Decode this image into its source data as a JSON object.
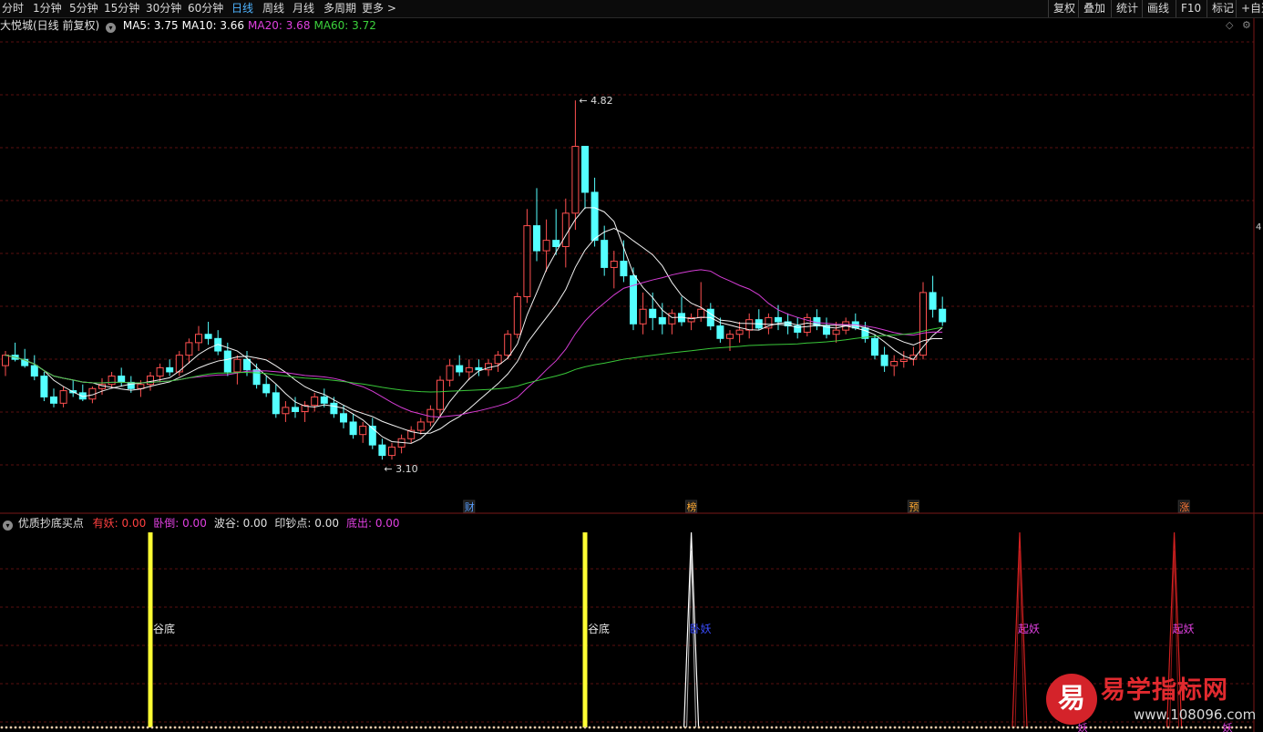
{
  "toolbar": {
    "periods": [
      {
        "label": "分时",
        "active": false
      },
      {
        "label": "1分钟",
        "active": false
      },
      {
        "label": "5分钟",
        "active": false
      },
      {
        "label": "15分钟",
        "active": false
      },
      {
        "label": "30分钟",
        "active": false
      },
      {
        "label": "60分钟",
        "active": false
      },
      {
        "label": "日线",
        "active": true
      },
      {
        "label": "周线",
        "active": false
      },
      {
        "label": "月线",
        "active": false
      },
      {
        "label": "多周期",
        "active": false
      },
      {
        "label": "更多 >",
        "active": false
      }
    ],
    "right_buttons": [
      "复权",
      "叠加",
      "统计",
      "画线",
      "F10",
      "标记",
      "+自选"
    ]
  },
  "main_chart": {
    "title": "大悦城(日线 前复权)",
    "ma": [
      {
        "label": "MA5: 3.75",
        "color": "#ffffff"
      },
      {
        "label": "MA10: 3.66",
        "color": "#ffffff"
      },
      {
        "label": "MA20: 3.68",
        "color": "#e040e0"
      },
      {
        "label": "MA60: 3.72",
        "color": "#3cd23c"
      }
    ],
    "high_label": "4.82",
    "low_label": "3.10",
    "edge_label": "4",
    "event_markers": [
      "财",
      "榜",
      "预",
      "涨"
    ]
  },
  "chart_data": {
    "type": "candlestick",
    "price_range": [
      2.9,
      5.1
    ],
    "high": 4.82,
    "low": 3.1,
    "candles": [
      [
        3.55,
        3.62,
        3.5,
        3.6
      ],
      [
        3.6,
        3.66,
        3.57,
        3.58
      ],
      [
        3.58,
        3.63,
        3.54,
        3.55
      ],
      [
        3.55,
        3.6,
        3.48,
        3.5
      ],
      [
        3.5,
        3.52,
        3.38,
        3.4
      ],
      [
        3.4,
        3.44,
        3.35,
        3.37
      ],
      [
        3.37,
        3.45,
        3.35,
        3.43
      ],
      [
        3.43,
        3.48,
        3.4,
        3.42
      ],
      [
        3.42,
        3.46,
        3.38,
        3.39
      ],
      [
        3.39,
        3.45,
        3.37,
        3.44
      ],
      [
        3.44,
        3.49,
        3.41,
        3.46
      ],
      [
        3.46,
        3.52,
        3.44,
        3.5
      ],
      [
        3.5,
        3.54,
        3.45,
        3.47
      ],
      [
        3.47,
        3.5,
        3.42,
        3.44
      ],
      [
        3.44,
        3.48,
        3.4,
        3.46
      ],
      [
        3.46,
        3.52,
        3.43,
        3.5
      ],
      [
        3.5,
        3.56,
        3.47,
        3.54
      ],
      [
        3.54,
        3.58,
        3.5,
        3.52
      ],
      [
        3.52,
        3.62,
        3.5,
        3.6
      ],
      [
        3.6,
        3.68,
        3.56,
        3.66
      ],
      [
        3.66,
        3.74,
        3.62,
        3.7
      ],
      [
        3.7,
        3.76,
        3.65,
        3.68
      ],
      [
        3.68,
        3.72,
        3.6,
        3.62
      ],
      [
        3.62,
        3.66,
        3.5,
        3.52
      ],
      [
        3.52,
        3.6,
        3.46,
        3.58
      ],
      [
        3.58,
        3.62,
        3.5,
        3.53
      ],
      [
        3.53,
        3.56,
        3.44,
        3.46
      ],
      [
        3.46,
        3.5,
        3.4,
        3.42
      ],
      [
        3.42,
        3.46,
        3.3,
        3.32
      ],
      [
        3.32,
        3.38,
        3.28,
        3.35
      ],
      [
        3.35,
        3.4,
        3.3,
        3.33
      ],
      [
        3.33,
        3.38,
        3.28,
        3.36
      ],
      [
        3.36,
        3.42,
        3.33,
        3.4
      ],
      [
        3.4,
        3.44,
        3.35,
        3.37
      ],
      [
        3.37,
        3.4,
        3.3,
        3.32
      ],
      [
        3.32,
        3.36,
        3.25,
        3.28
      ],
      [
        3.28,
        3.32,
        3.2,
        3.22
      ],
      [
        3.22,
        3.28,
        3.18,
        3.26
      ],
      [
        3.26,
        3.3,
        3.15,
        3.17
      ],
      [
        3.17,
        3.2,
        3.1,
        3.12
      ],
      [
        3.12,
        3.18,
        3.1,
        3.16
      ],
      [
        3.16,
        3.22,
        3.13,
        3.2
      ],
      [
        3.2,
        3.26,
        3.18,
        3.24
      ],
      [
        3.24,
        3.3,
        3.22,
        3.28
      ],
      [
        3.28,
        3.36,
        3.26,
        3.34
      ],
      [
        3.34,
        3.5,
        3.3,
        3.48
      ],
      [
        3.48,
        3.58,
        3.45,
        3.55
      ],
      [
        3.55,
        3.6,
        3.5,
        3.52
      ],
      [
        3.52,
        3.58,
        3.48,
        3.54
      ],
      [
        3.54,
        3.58,
        3.5,
        3.53
      ],
      [
        3.53,
        3.58,
        3.5,
        3.56
      ],
      [
        3.56,
        3.62,
        3.52,
        3.6
      ],
      [
        3.6,
        3.72,
        3.58,
        3.7
      ],
      [
        3.7,
        3.9,
        3.68,
        3.88
      ],
      [
        3.88,
        4.3,
        3.85,
        4.22
      ],
      [
        4.22,
        4.4,
        4.05,
        4.1
      ],
      [
        4.1,
        4.25,
        4.0,
        4.15
      ],
      [
        4.15,
        4.3,
        4.08,
        4.12
      ],
      [
        4.12,
        4.35,
        4.02,
        4.28
      ],
      [
        4.28,
        4.82,
        4.2,
        4.6
      ],
      [
        4.6,
        4.55,
        4.3,
        4.38
      ],
      [
        4.38,
        4.45,
        4.12,
        4.15
      ],
      [
        4.15,
        4.22,
        3.98,
        4.02
      ],
      [
        4.02,
        4.1,
        3.92,
        4.05
      ],
      [
        4.05,
        4.15,
        3.95,
        3.98
      ],
      [
        3.98,
        4.02,
        3.72,
        3.75
      ],
      [
        3.75,
        3.9,
        3.7,
        3.82
      ],
      [
        3.82,
        3.9,
        3.72,
        3.78
      ],
      [
        3.78,
        3.85,
        3.7,
        3.75
      ],
      [
        3.75,
        3.82,
        3.7,
        3.8
      ],
      [
        3.8,
        3.88,
        3.74,
        3.76
      ],
      [
        3.76,
        3.8,
        3.72,
        3.78
      ],
      [
        3.78,
        3.95,
        3.76,
        3.82
      ],
      [
        3.82,
        3.85,
        3.72,
        3.74
      ],
      [
        3.74,
        3.78,
        3.66,
        3.68
      ],
      [
        3.68,
        3.72,
        3.62,
        3.7
      ],
      [
        3.7,
        3.76,
        3.66,
        3.72
      ],
      [
        3.72,
        3.8,
        3.68,
        3.77
      ],
      [
        3.77,
        3.82,
        3.72,
        3.73
      ],
      [
        3.73,
        3.8,
        3.7,
        3.78
      ],
      [
        3.78,
        3.84,
        3.72,
        3.76
      ],
      [
        3.76,
        3.8,
        3.7,
        3.74
      ],
      [
        3.74,
        3.78,
        3.68,
        3.71
      ],
      [
        3.71,
        3.8,
        3.69,
        3.78
      ],
      [
        3.78,
        3.82,
        3.72,
        3.74
      ],
      [
        3.74,
        3.78,
        3.68,
        3.7
      ],
      [
        3.7,
        3.76,
        3.66,
        3.72
      ],
      [
        3.72,
        3.78,
        3.7,
        3.76
      ],
      [
        3.76,
        3.8,
        3.72,
        3.73
      ],
      [
        3.73,
        3.76,
        3.66,
        3.68
      ],
      [
        3.68,
        3.7,
        3.58,
        3.6
      ],
      [
        3.6,
        3.64,
        3.52,
        3.55
      ],
      [
        3.55,
        3.6,
        3.5,
        3.57
      ],
      [
        3.57,
        3.62,
        3.54,
        3.58
      ],
      [
        3.58,
        3.64,
        3.55,
        3.6
      ],
      [
        3.6,
        3.95,
        3.58,
        3.9
      ],
      [
        3.9,
        3.98,
        3.78,
        3.82
      ],
      [
        3.82,
        3.88,
        3.74,
        3.76
      ]
    ],
    "series": [
      {
        "name": "MA5",
        "color": "#ffffff"
      },
      {
        "name": "MA10",
        "color": "#ffffff"
      },
      {
        "name": "MA20",
        "color": "#e040e0"
      },
      {
        "name": "MA60",
        "color": "#3cd23c"
      }
    ]
  },
  "sub_chart": {
    "title": "优质抄底买点",
    "indicators": [
      {
        "label": "有妖: 0.00",
        "color": "#ff4040"
      },
      {
        "label": "卧倒: 0.00",
        "color": "#e040e0"
      },
      {
        "label": "波谷: 0.00",
        "color": "#e0e0e0"
      },
      {
        "label": "印钞点: 0.00",
        "color": "#e0e0e0"
      },
      {
        "label": "底出: 0.00",
        "color": "#e040e0"
      }
    ],
    "signals": [
      {
        "kind": "bar",
        "label": "谷底",
        "index": 15,
        "color": "#ffff33"
      },
      {
        "kind": "bar",
        "label": "谷底",
        "index": 60,
        "color": "#ffff33"
      },
      {
        "kind": "spike",
        "label": "卧妖",
        "index": 71,
        "color": "#ffffff"
      },
      {
        "kind": "spike",
        "label": "起妖",
        "index": 105,
        "color": "#d22020"
      },
      {
        "kind": "spike",
        "label": "起妖",
        "index": 121,
        "color": "#d22020"
      }
    ],
    "bottom_labels": [
      "妖",
      "妖"
    ]
  },
  "watermark": {
    "logo_char": "易",
    "title": "易学指标网",
    "url": "www.108096.com"
  }
}
